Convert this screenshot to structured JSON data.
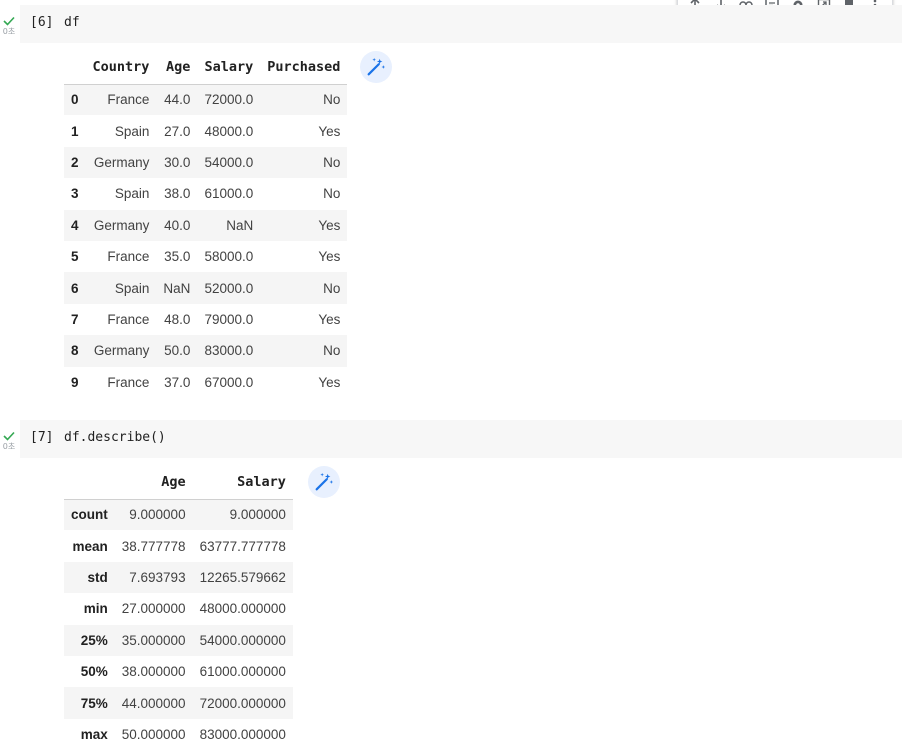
{
  "toolbar": {
    "buttons": [
      "move-up-icon",
      "move-down-icon",
      "link-icon",
      "comment-icon",
      "settings-icon",
      "mirror-cell-icon",
      "delete-icon",
      "more-icon"
    ]
  },
  "cell1": {
    "exec_time": "0초",
    "prompt": "[6]",
    "code": "df",
    "table": {
      "columns": [
        "",
        "Country",
        "Age",
        "Salary",
        "Purchased"
      ],
      "rows": [
        [
          "0",
          "France",
          "44.0",
          "72000.0",
          "No"
        ],
        [
          "1",
          "Spain",
          "27.0",
          "48000.0",
          "Yes"
        ],
        [
          "2",
          "Germany",
          "30.0",
          "54000.0",
          "No"
        ],
        [
          "3",
          "Spain",
          "38.0",
          "61000.0",
          "No"
        ],
        [
          "4",
          "Germany",
          "40.0",
          "NaN",
          "Yes"
        ],
        [
          "5",
          "France",
          "35.0",
          "58000.0",
          "Yes"
        ],
        [
          "6",
          "Spain",
          "NaN",
          "52000.0",
          "No"
        ],
        [
          "7",
          "France",
          "48.0",
          "79000.0",
          "Yes"
        ],
        [
          "8",
          "Germany",
          "50.0",
          "83000.0",
          "No"
        ],
        [
          "9",
          "France",
          "37.0",
          "67000.0",
          "Yes"
        ]
      ]
    }
  },
  "cell2": {
    "exec_time": "0초",
    "prompt": "[7]",
    "code": "df.describe()",
    "table": {
      "columns": [
        "",
        "Age",
        "Salary"
      ],
      "rows": [
        [
          "count",
          "9.000000",
          "9.000000"
        ],
        [
          "mean",
          "38.777778",
          "63777.777778"
        ],
        [
          "std",
          "7.693793",
          "12265.579662"
        ],
        [
          "min",
          "27.000000",
          "48000.000000"
        ],
        [
          "25%",
          "35.000000",
          "54000.000000"
        ],
        [
          "50%",
          "38.000000",
          "61000.000000"
        ],
        [
          "75%",
          "44.000000",
          "72000.000000"
        ],
        [
          "max",
          "50.000000",
          "83000.000000"
        ]
      ]
    }
  },
  "colors": {
    "check": "#34a853",
    "code_bg": "#f7f7f7",
    "stripe": "#f5f5f5",
    "magic_bg": "#e8f0fe",
    "magic_icon": "#1a73e8"
  }
}
